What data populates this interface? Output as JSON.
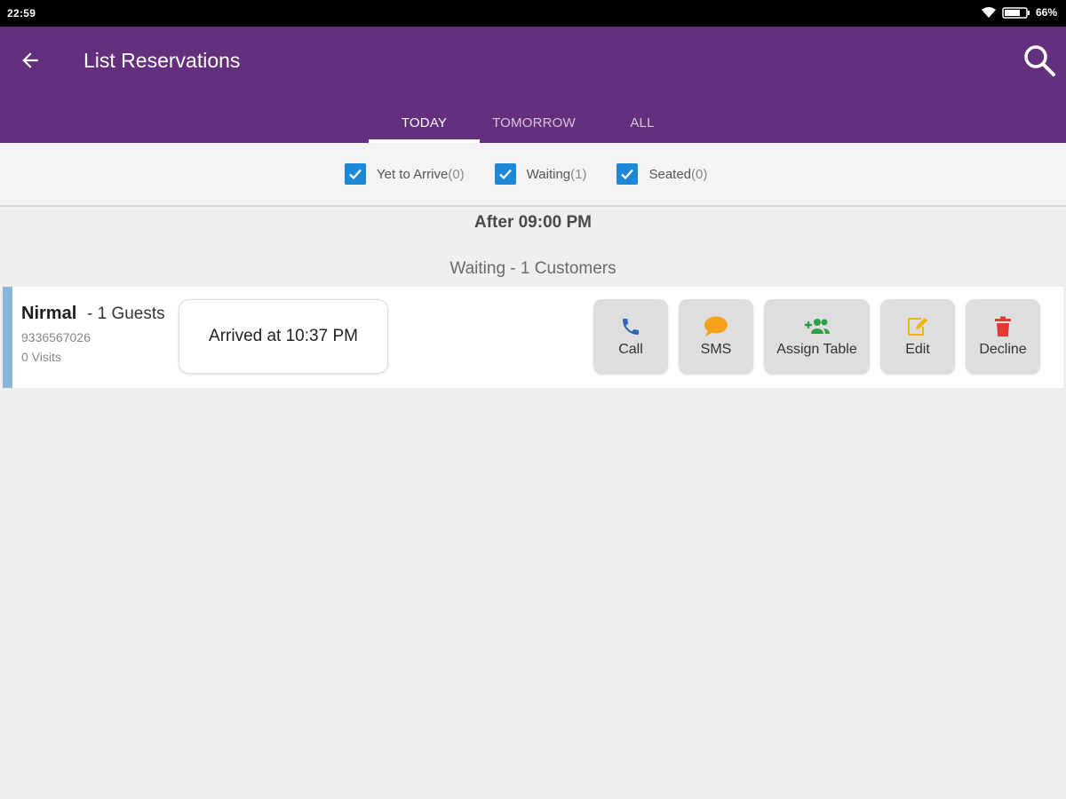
{
  "status_bar": {
    "time": "22:59",
    "battery": "66%"
  },
  "app_bar": {
    "title": "List Reservations"
  },
  "tabs": [
    {
      "label": "TODAY",
      "active": true
    },
    {
      "label": "TOMORROW",
      "active": false
    },
    {
      "label": "ALL",
      "active": false
    }
  ],
  "filters": [
    {
      "label": "Yet to Arrive",
      "count": "(0)",
      "checked": true
    },
    {
      "label": "Waiting",
      "count": "(1)",
      "checked": true
    },
    {
      "label": "Seated",
      "count": "(0)",
      "checked": true
    }
  ],
  "time_heading": "After 09:00 PM",
  "group_heading": "Waiting - 1 Customers",
  "reservation": {
    "name": "Nirmal",
    "guests": "- 1 Guests",
    "phone": "9336567026",
    "visits": "0 Visits",
    "arrival": "Arrived at 10:37 PM",
    "actions": [
      {
        "label": "Call",
        "icon": "phone-icon",
        "color": "#2f67b5"
      },
      {
        "label": "SMS",
        "icon": "chat-bubble-icon",
        "color": "#f2a21a"
      },
      {
        "label": "Assign Table",
        "icon": "add-people-icon",
        "color": "#2ca244"
      },
      {
        "label": "Edit",
        "icon": "edit-icon",
        "color": "#f4b400"
      },
      {
        "label": "Decline",
        "icon": "trash-icon",
        "color": "#e53935"
      }
    ]
  },
  "colors": {
    "app_bar": "#642f7d",
    "checkbox": "#1e88d8",
    "row_accent": "#87b8dc"
  }
}
